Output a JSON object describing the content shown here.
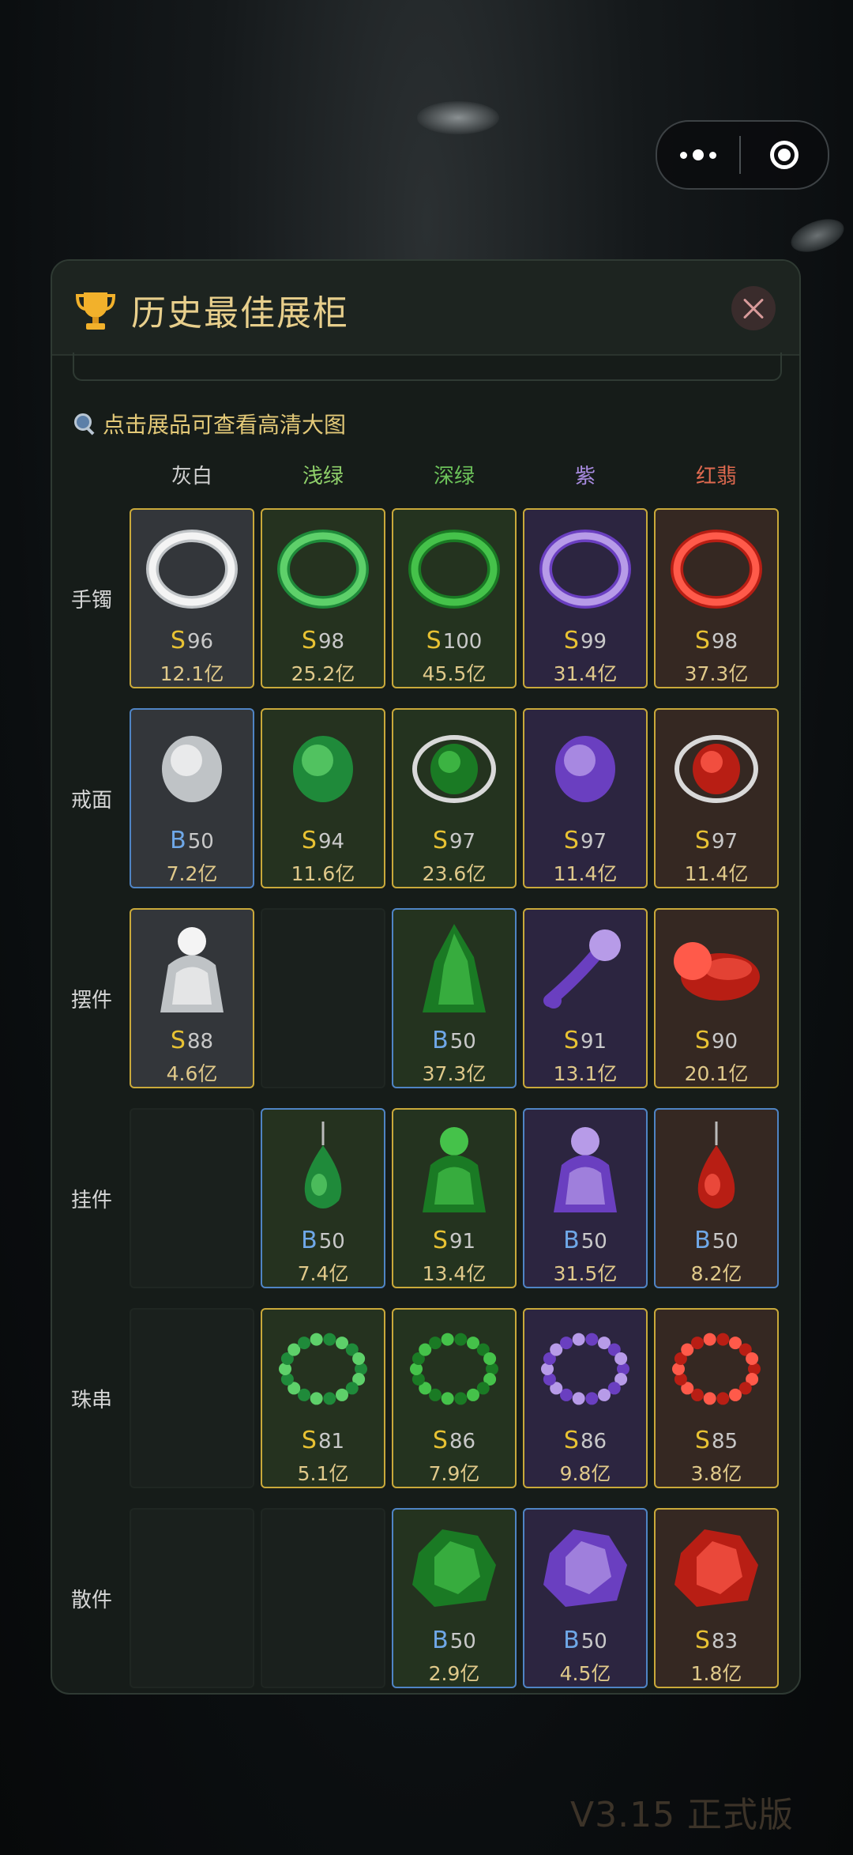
{
  "capsule": {
    "more_icon": "more-dots-icon",
    "target_icon": "target-icon"
  },
  "panel": {
    "title": "历史最佳展柜",
    "hint": "点击展品可查看高清大图",
    "close_icon": "close-icon",
    "columns": [
      "灰白",
      "浅绿",
      "深绿",
      "紫",
      "红翡"
    ],
    "column_colors": [
      "#cfcfcf",
      "#8fd06a",
      "#6cc25a",
      "#a88be0",
      "#e06a50"
    ],
    "rows": [
      "手镯",
      "戒面",
      "摆件",
      "挂件",
      "珠串",
      "散件"
    ],
    "cells": [
      [
        {
          "grade": "S",
          "score": "96",
          "value": "12.1亿"
        },
        {
          "grade": "S",
          "score": "98",
          "value": "25.2亿"
        },
        {
          "grade": "S",
          "score": "100",
          "value": "45.5亿"
        },
        {
          "grade": "S",
          "score": "99",
          "value": "31.4亿"
        },
        {
          "grade": "S",
          "score": "98",
          "value": "37.3亿"
        }
      ],
      [
        {
          "grade": "B",
          "score": "50",
          "value": "7.2亿"
        },
        {
          "grade": "S",
          "score": "94",
          "value": "11.6亿"
        },
        {
          "grade": "S",
          "score": "97",
          "value": "23.6亿"
        },
        {
          "grade": "S",
          "score": "97",
          "value": "11.4亿"
        },
        {
          "grade": "S",
          "score": "97",
          "value": "11.4亿"
        }
      ],
      [
        {
          "grade": "S",
          "score": "88",
          "value": "4.6亿"
        },
        null,
        {
          "grade": "B",
          "score": "50",
          "value": "37.3亿"
        },
        {
          "grade": "S",
          "score": "91",
          "value": "13.1亿"
        },
        {
          "grade": "S",
          "score": "90",
          "value": "20.1亿"
        }
      ],
      [
        null,
        {
          "grade": "B",
          "score": "50",
          "value": "7.4亿"
        },
        {
          "grade": "S",
          "score": "91",
          "value": "13.4亿"
        },
        {
          "grade": "B",
          "score": "50",
          "value": "31.5亿"
        },
        {
          "grade": "B",
          "score": "50",
          "value": "8.2亿"
        }
      ],
      [
        null,
        {
          "grade": "S",
          "score": "81",
          "value": "5.1亿"
        },
        {
          "grade": "S",
          "score": "86",
          "value": "7.9亿"
        },
        {
          "grade": "S",
          "score": "86",
          "value": "9.8亿"
        },
        {
          "grade": "S",
          "score": "85",
          "value": "3.8亿"
        }
      ],
      [
        null,
        null,
        {
          "grade": "B",
          "score": "50",
          "value": "2.9亿"
        },
        {
          "grade": "B",
          "score": "50",
          "value": "4.5亿"
        },
        {
          "grade": "S",
          "score": "83",
          "value": "1.8亿"
        }
      ]
    ]
  },
  "version": "V3.15 正式版"
}
